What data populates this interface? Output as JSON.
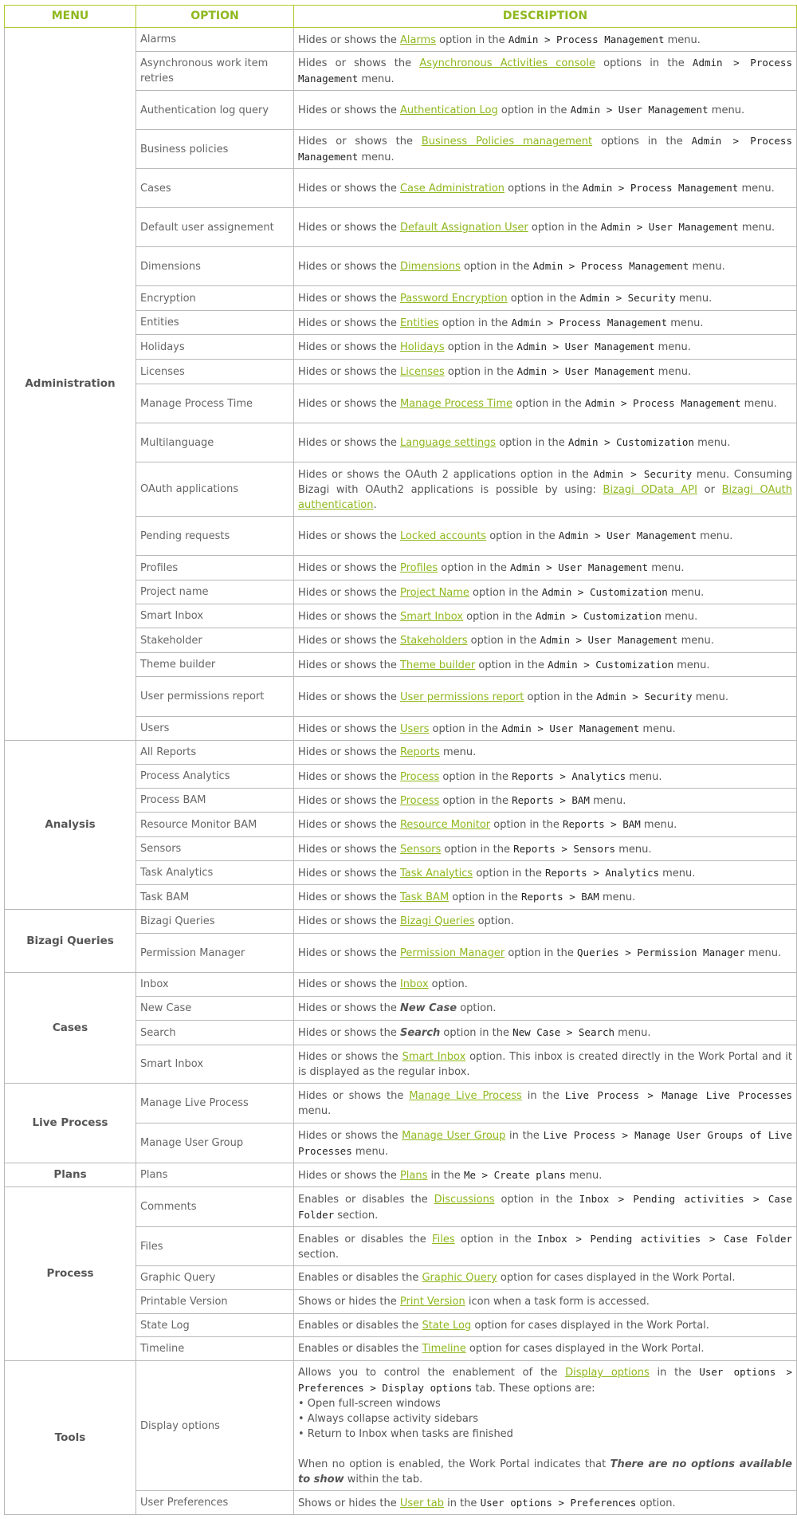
{
  "columns": {
    "menu": "MENU",
    "option": "OPTION",
    "description": "DESCRIPTION"
  },
  "menus": {
    "administration": "Administration",
    "analysis": "Analysis",
    "bizagi_queries": "Bizagi Queries",
    "cases": "Cases",
    "live_process": "Live Process",
    "plans": "Plans",
    "process": "Process",
    "tools": "Tools"
  },
  "rows": [
    {
      "option": "Alarms",
      "parts": [
        "Hides or shows the ",
        "Alarms",
        " option in the ",
        "Admin > Process Management",
        " menu."
      ]
    },
    {
      "option": "Asynchronous work item retries",
      "parts": [
        "Hides or shows the ",
        "Asynchronous Activities console",
        " options in the ",
        "Admin > Process Management",
        " menu."
      ]
    },
    {
      "option": "Authentication log query",
      "parts": [
        "Hides or shows the ",
        "Authentication Log",
        " option in the ",
        "Admin > User Management",
        " menu."
      ]
    },
    {
      "option": "Business policies",
      "parts": [
        "Hides or shows the ",
        "Business Policies management",
        " options in the ",
        "Admin > Process Management",
        " menu."
      ]
    },
    {
      "option": "Cases",
      "parts": [
        "Hides or shows the ",
        "Case Administration",
        " options in the ",
        "Admin > Process Management",
        " menu."
      ]
    },
    {
      "option": "Default user assignement",
      "parts": [
        "Hides or shows the ",
        "Default Assignation User",
        " option in the ",
        "Admin > User Management",
        " menu."
      ]
    },
    {
      "option": "Dimensions",
      "parts": [
        "Hides or shows the ",
        "Dimensions",
        " option in the ",
        "Admin > Process Management",
        " menu."
      ]
    },
    {
      "option": "Encryption",
      "parts": [
        "Hides or shows the ",
        "Password Encryption",
        " option in the ",
        "Admin > Security",
        " menu."
      ]
    },
    {
      "option": "Entities",
      "parts": [
        "Hides or shows the ",
        "Entities",
        " option in the ",
        "Admin > Process Management",
        " menu."
      ]
    },
    {
      "option": "Holidays",
      "parts": [
        "Hides or shows the ",
        "Holidays",
        " option in the ",
        "Admin > User Management",
        " menu."
      ]
    },
    {
      "option": "Licenses",
      "parts": [
        "Hides or shows the ",
        "Licenses",
        " option in the ",
        "Admin > User Management",
        " menu."
      ]
    },
    {
      "option": "Manage Process Time",
      "parts": [
        "Hides or shows the ",
        "Manage Process Time",
        " option in the ",
        "Admin > Process Management",
        " menu."
      ]
    },
    {
      "option": "Multilanguage",
      "parts": [
        "Hides or shows the ",
        "Language settings",
        " option in the ",
        "Admin > Customization",
        " menu."
      ]
    },
    {
      "option": "OAuth applications",
      "parts": [
        "Hides or shows the OAuth 2 applications option in the ",
        "Admin > Security",
        " menu. Consuming Bizagi with OAuth2 applications is possible by using: ",
        "Bizagi OData API",
        " or ",
        "Bizagi OAuth authentication",
        "."
      ]
    },
    {
      "option": "Pending requests",
      "parts": [
        "Hides or shows the ",
        "Locked accounts",
        " option in the ",
        "Admin > User Management",
        " menu."
      ]
    },
    {
      "option": "Profiles",
      "parts": [
        "Hides or shows the ",
        "Profiles",
        " option in the ",
        "Admin > User Management",
        " menu."
      ]
    },
    {
      "option": "Project name",
      "parts": [
        "Hides or shows the ",
        "Project Name",
        " option in the ",
        "Admin > Customization",
        " menu."
      ]
    },
    {
      "option": "Smart Inbox",
      "parts": [
        "Hides or shows the ",
        "Smart Inbox",
        " option in the ",
        "Admin > Customization",
        " menu."
      ]
    },
    {
      "option": "Stakeholder",
      "parts": [
        "Hides or shows the ",
        "Stakeholders",
        " option in the ",
        "Admin > User Management",
        " menu."
      ]
    },
    {
      "option": "Theme builder",
      "parts": [
        "Hides or shows the ",
        "Theme builder",
        " option in the ",
        "Admin > Customization",
        " menu."
      ]
    },
    {
      "option": "User permissions report",
      "parts": [
        "Hides or shows the ",
        "User permissions report",
        " option in the ",
        "Admin > Security",
        " menu."
      ]
    },
    {
      "option": "Users",
      "parts": [
        "Hides or shows the ",
        "Users",
        " option in the ",
        "Admin > User Management",
        " menu."
      ]
    },
    {
      "option": "All Reports",
      "parts": [
        "Hides or shows the ",
        "Reports",
        " menu."
      ]
    },
    {
      "option": "Process Analytics",
      "parts": [
        "Hides or shows the ",
        "Process",
        " option in the ",
        "Reports > Analytics",
        " menu."
      ]
    },
    {
      "option": "Process BAM",
      "parts": [
        "Hides or shows the ",
        "Process",
        " option in the ",
        "Reports > BAM",
        " menu."
      ]
    },
    {
      "option": "Resource Monitor BAM",
      "parts": [
        "Hides or shows the ",
        "Resource Monitor",
        " option in the ",
        "Reports > BAM",
        " menu."
      ]
    },
    {
      "option": "Sensors",
      "parts": [
        "Hides or shows the ",
        "Sensors",
        " option in the ",
        "Reports > Sensors",
        " menu."
      ]
    },
    {
      "option": "Task Analytics",
      "parts": [
        "Hides or shows the ",
        "Task Analytics",
        " option in the ",
        "Reports > Analytics",
        " menu."
      ]
    },
    {
      "option": "Task BAM",
      "parts": [
        "Hides or shows the ",
        "Task BAM",
        " option in the ",
        "Reports > BAM",
        " menu."
      ]
    },
    {
      "option": "Bizagi Queries",
      "parts": [
        "Hides or shows the ",
        "Bizagi Queries",
        " option."
      ]
    },
    {
      "option": "Permission Manager",
      "parts": [
        "Hides or shows the ",
        "Permission Manager",
        " option in the ",
        "Queries > Permission Manager",
        " menu."
      ]
    },
    {
      "option": "Inbox",
      "parts": [
        "Hides or shows the ",
        "Inbox",
        " option."
      ]
    },
    {
      "option": "New Case",
      "parts": [
        "Hides or shows the ",
        "New Case",
        " option."
      ]
    },
    {
      "option": "Search",
      "parts": [
        "Hides or shows the ",
        "Search",
        " option in the ",
        "New Case > Search",
        " menu."
      ]
    },
    {
      "option": "Smart Inbox",
      "parts": [
        "Hides or shows the ",
        "Smart Inbox",
        " option. This inbox is created directly in the Work Portal and it is displayed as the regular inbox."
      ]
    },
    {
      "option": "Manage Live Process",
      "parts": [
        "Hides or shows the ",
        "Manage Live Process",
        " in the ",
        "Live Process > Manage Live Processes",
        " menu."
      ]
    },
    {
      "option": "Manage User Group",
      "parts": [
        "Hides or shows the ",
        "Manage User Group",
        " in the ",
        "Live Process > Manage User Groups of Live Processes",
        " menu."
      ]
    },
    {
      "option": "Plans",
      "parts": [
        "Hides or shows the ",
        "Plans",
        " in the ",
        "Me > Create plans",
        " menu."
      ]
    },
    {
      "option": "Comments",
      "parts": [
        "Enables or disables the ",
        "Discussions",
        " option in the ",
        "Inbox > Pending activities > Case Folder",
        " section."
      ]
    },
    {
      "option": "Files",
      "parts": [
        "Enables or disables the ",
        "Files",
        " option in the ",
        "Inbox > Pending activities > Case Folder",
        " section."
      ]
    },
    {
      "option": "Graphic Query",
      "parts": [
        "Enables or disables the ",
        "Graphic Query",
        " option for cases displayed in the Work Portal."
      ]
    },
    {
      "option": "Printable Version",
      "parts": [
        "Shows or hides the ",
        "Print Version",
        " icon when a task form is accessed."
      ]
    },
    {
      "option": "State Log",
      "parts": [
        "Enables or disables the ",
        "State Log",
        " option for cases displayed in the Work Portal."
      ]
    },
    {
      "option": "Timeline",
      "parts": [
        "Enables or disables the ",
        "Timeline",
        " option for cases displayed in the Work Portal."
      ]
    },
    {
      "option": "Display options",
      "parts": [
        "Allows you to control the enablement of the ",
        "Display options",
        " in the ",
        "User options > Preferences > Display options",
        " tab. These options are:",
        "• Open full-screen windows",
        "• Always collapse activity sidebars",
        "• Return to Inbox when tasks are finished",
        "When no option is enabled, the Work Portal indicates that ",
        "There are no options available to show",
        " within the tab."
      ]
    },
    {
      "option": "User Preferences",
      "parts": [
        "Shows or hides the ",
        "User tab",
        " in the ",
        "User options > Preferences",
        " option."
      ]
    }
  ]
}
